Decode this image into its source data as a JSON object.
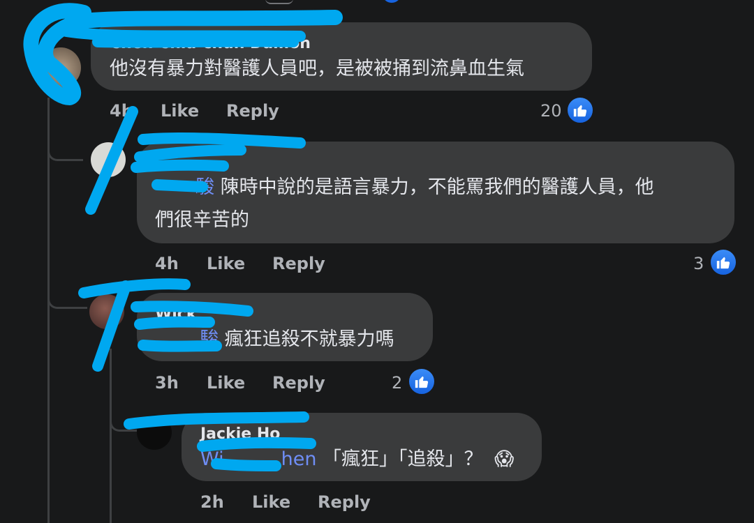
{
  "comments": [
    {
      "author": "Chen Chia-chun Damon",
      "text": "他沒有暴力對醫護人員吧，是被被捅到流鼻血生氣",
      "time": "4h",
      "like_label": "Like",
      "reply_label": "Reply",
      "like_count": "20"
    },
    {
      "author": "",
      "mention": "駿",
      "text_line1": " 陳時中說的是語言暴力，不能罵我們的醫護人員，他",
      "text_line2": "們很辛苦的",
      "time": "4h",
      "like_label": "Like",
      "reply_label": "Reply",
      "like_count": "3"
    },
    {
      "author": "Wick",
      "mention": "駿",
      "text": " 瘋狂追殺不就暴力嗎",
      "time": "3h",
      "like_label": "Like",
      "reply_label": "Reply",
      "like_count": "2"
    },
    {
      "author": "Jackie Ho",
      "mention": "Wi",
      "mention_tail": "hen",
      "text": " 「瘋狂」「追殺」？",
      "emoji": "😱",
      "time": "2h",
      "like_label": "Like",
      "reply_label": "Reply"
    }
  ],
  "colors": {
    "background": "#18191a",
    "bubble": "#3a3b3c",
    "mention": "#6f8ef5",
    "like_blue": "#1877f2",
    "redaction": "#00a8f0"
  },
  "icons": [
    "thumbs-up-icon"
  ]
}
